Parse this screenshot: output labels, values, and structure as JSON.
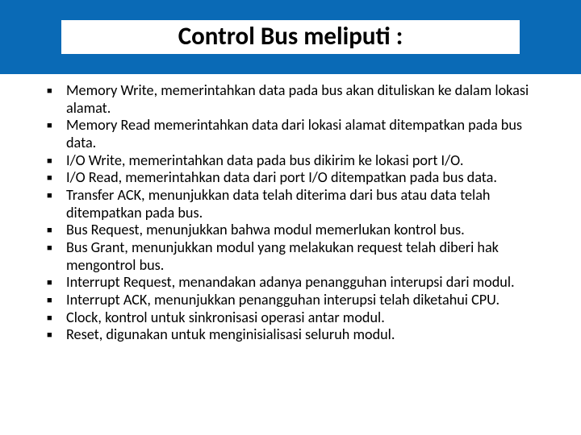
{
  "title": "Control Bus meliputi :",
  "items": [
    "Memory Write, memerintahkan data pada bus akan dituliskan ke dalam lokasi alamat.",
    "Memory Read memerintahkan data dari lokasi alamat ditempatkan pada bus data.",
    "I/O Write, memerintahkan data pada bus dikirim ke lokasi port I/O.",
    "I/O Read, memerintahkan data dari port I/O ditempatkan pada bus data.",
    "Transfer ACK, menunjukkan data telah diterima dari bus atau data telah ditempatkan pada bus.",
    "Bus Request, menunjukkan bahwa modul memerlukan kontrol bus.",
    "Bus Grant, menunjukkan modul yang melakukan request telah diberi hak mengontrol bus.",
    "Interrupt Request, menandakan adanya penangguhan interupsi dari modul.",
    "Interrupt ACK, menunjukkan penangguhan interupsi telah diketahui CPU.",
    "Clock, kontrol untuk sinkronisasi operasi antar modul.",
    "Reset, digunakan untuk menginisialisasi seluruh modul."
  ]
}
